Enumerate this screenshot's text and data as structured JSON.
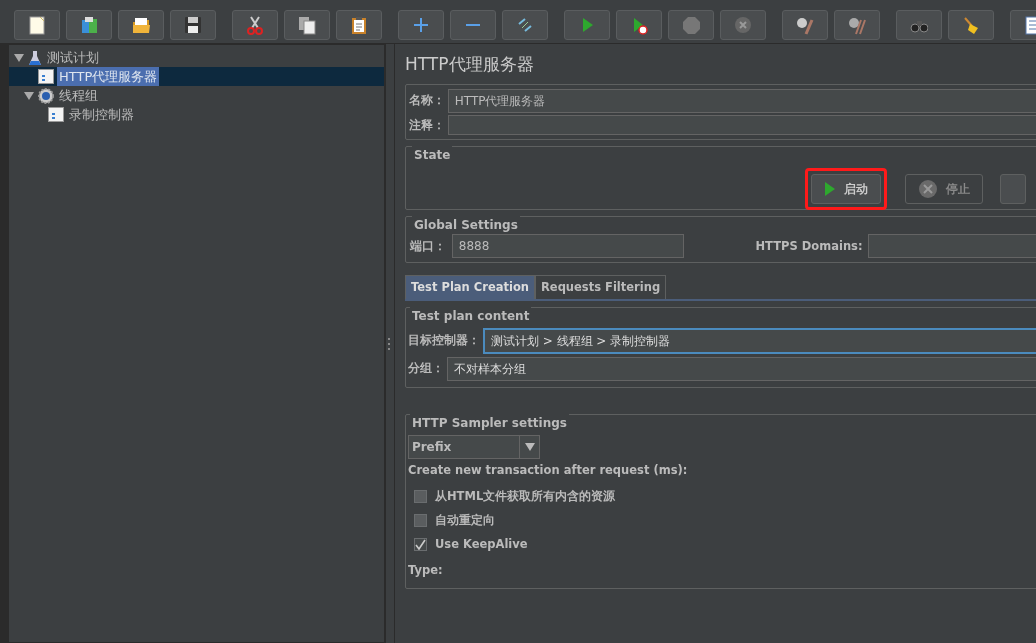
{
  "tree": [
    {
      "label": "测试计划",
      "kind": "plan",
      "expanded": true,
      "selected": false,
      "children": [
        {
          "label": "HTTP代理服务器",
          "kind": "element",
          "selected": true
        },
        {
          "label": "线程组",
          "kind": "group",
          "expanded": true,
          "selected": false,
          "children": [
            {
              "label": "录制控制器",
              "kind": "element",
              "selected": false
            }
          ]
        }
      ]
    }
  ],
  "panel": {
    "title": "HTTP代理服务器",
    "name_label": "名称：",
    "name_value": "HTTP代理服务器",
    "comment_label": "注释：",
    "state": {
      "legend": "State",
      "buttons": [
        {
          "label": "启动",
          "kind": "start",
          "disabled": false,
          "highlighted": true
        },
        {
          "label": "停止",
          "kind": "stop",
          "disabled": true,
          "highlighted": false
        }
      ]
    },
    "global": {
      "legend": "Global Settings",
      "port_label": "端口：",
      "port_value": "8888",
      "https_label": "HTTPS Domains:"
    },
    "tabs": [
      {
        "label": "Test Plan Creation",
        "selected": true
      },
      {
        "label": "Requests Filtering",
        "selected": false
      }
    ],
    "test_plan": {
      "legend": "Test plan content",
      "target_label": "目标控制器：",
      "target_value": "测试计划 > 线程组 > 录制控制器",
      "group_label": "分组：",
      "group_value": "不对样本分组"
    },
    "sampler": {
      "legend": "HTTP Sampler settings",
      "naming": "Prefix",
      "transaction_label": "Create new transaction after request (ms):",
      "options": [
        {
          "label": "从HTML文件获取所有内含的资源",
          "checked": false
        },
        {
          "label": "自动重定向",
          "checked": false
        },
        {
          "label": "Use KeepAlive",
          "checked": true
        }
      ],
      "type_label": "Type:"
    }
  }
}
